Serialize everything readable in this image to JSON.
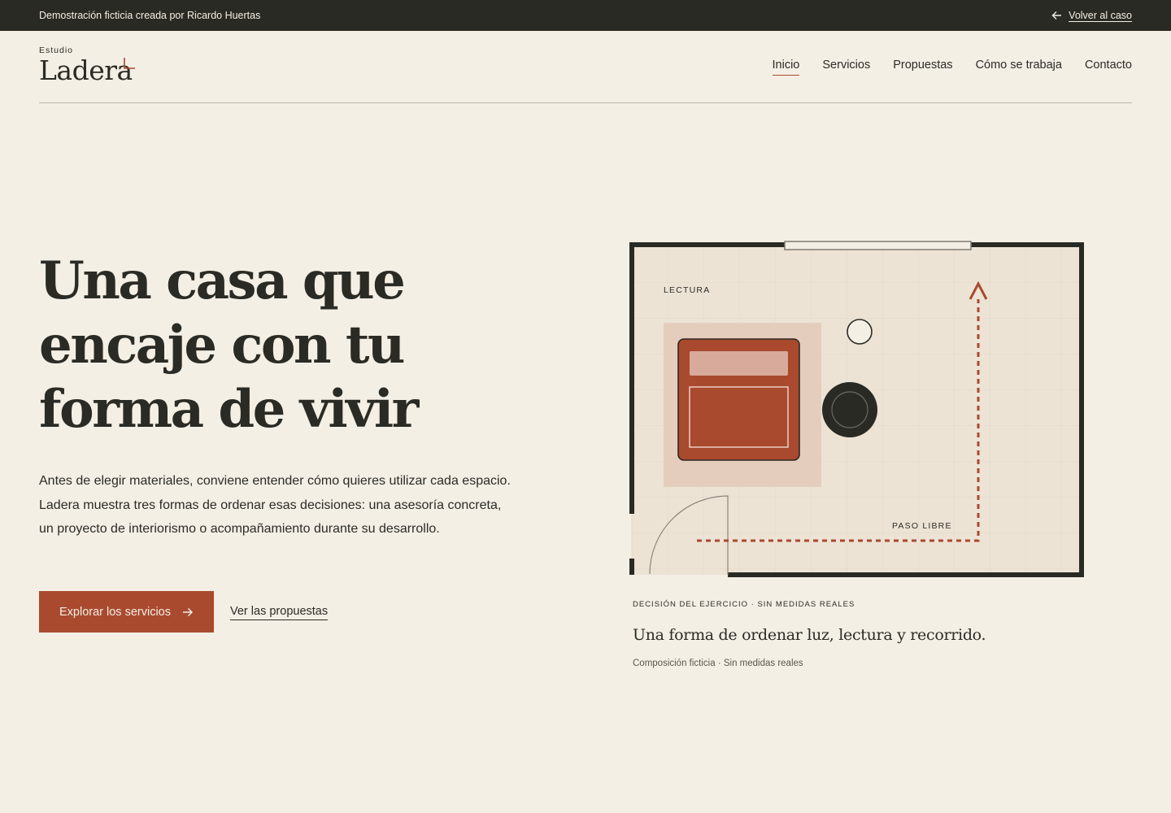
{
  "topbar": {
    "demo_text": "Demostración ficticia creada por Ricardo Huertas",
    "back_label": "Volver al caso"
  },
  "header": {
    "logo_small": "Estudio",
    "logo_big": "Ladera",
    "nav": [
      {
        "label": "Inicio",
        "active": true
      },
      {
        "label": "Servicios",
        "active": false
      },
      {
        "label": "Propuestas",
        "active": false
      },
      {
        "label": "Cómo se trabaja",
        "active": false
      },
      {
        "label": "Contacto",
        "active": false
      }
    ]
  },
  "hero": {
    "title_lines": [
      "Una casa que",
      "encaje con tu",
      "forma de vivir"
    ],
    "description": "Antes de elegir materiales, conviene entender cómo quieres utilizar cada espacio. Ladera muestra tres formas de ordenar esas decisiones: una asesoría concreta, un proyecto de interiorismo o acompañamiento durante su desarrollo.",
    "primary_cta": "Explorar los servicios",
    "secondary_cta": "Ver las propuestas"
  },
  "plan": {
    "label_reading": "LECTURA",
    "label_path": "PASO LIBRE",
    "caption_kicker": "DECISIÓN DEL EJERCICIO · SIN MEDIDAS REALES",
    "caption_title": "Una forma de ordenar luz, lectura y recorrido.",
    "caption_note": "Composición ficticia · Sin medidas reales"
  },
  "colors": {
    "background": "#f4efe5",
    "dark": "#2a2a24",
    "accent": "#a94a2f",
    "plan_floor": "#ede3d5",
    "rug": "#e5cdbd"
  }
}
